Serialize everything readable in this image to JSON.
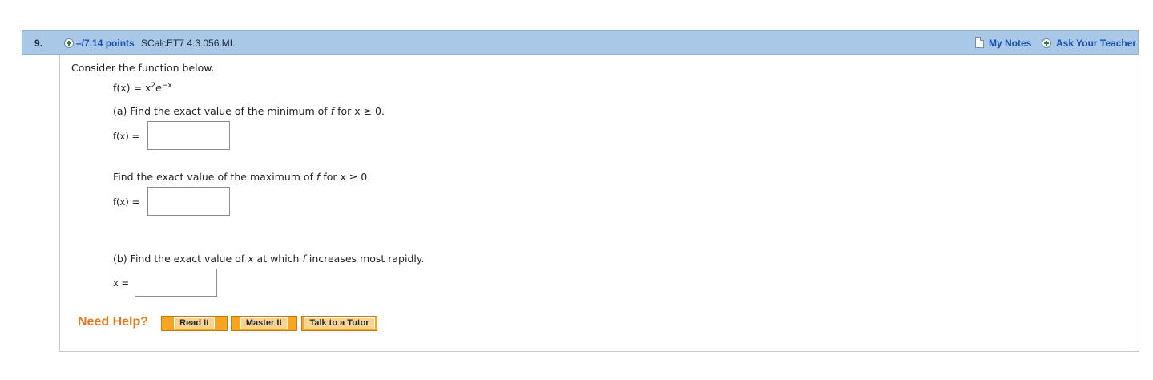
{
  "question": {
    "number": "9.",
    "points": "–/7.14 points",
    "code": "SCalcET7 4.3.056.MI.",
    "my_notes": "My Notes",
    "ask_teacher": "Ask Your Teacher"
  },
  "body": {
    "intro": "Consider the function below.",
    "function_lhs": "f(x) = x",
    "function_exp1": "2",
    "function_base": "e",
    "function_exp2": "−x",
    "part_a_prefix": "(a) Find the exact value of the minimum of ",
    "part_a_var": "f",
    "part_a_suffix": " for x ≥ 0.",
    "min_label": "f(x) =",
    "min_value": "",
    "max_prefix": "Find the exact value of the maximum of ",
    "max_var": "f",
    "max_suffix": " for x ≥ 0.",
    "max_label": "f(x) =",
    "max_value": "",
    "part_b_prefix": "(b) Find the exact value of ",
    "part_b_var": "x",
    "part_b_mid": " at which ",
    "part_b_var2": "f",
    "part_b_suffix": " increases most rapidly.",
    "x_label": "x =",
    "x_value": ""
  },
  "help": {
    "title": "Need Help?",
    "read_it": "Read It",
    "master_it": "Master It",
    "talk_tutor": "Talk to a Tutor"
  }
}
